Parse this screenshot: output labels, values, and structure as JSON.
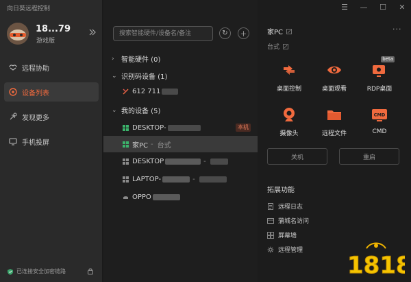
{
  "app": {
    "title": "向日葵远程控制"
  },
  "user": {
    "name": "18...79",
    "edition": "游戏版"
  },
  "nav": [
    {
      "label": "远程协助",
      "icon": "remote-assist-icon",
      "active": false
    },
    {
      "label": "设备列表",
      "icon": "device-list-icon",
      "active": true
    },
    {
      "label": "发现更多",
      "icon": "discover-icon",
      "active": false
    },
    {
      "label": "手机投屏",
      "icon": "screen-cast-icon",
      "active": false
    }
  ],
  "status": {
    "secure_link": "已连接安全加密链路"
  },
  "search": {
    "placeholder": "搜索智能硬件/设备名/备注"
  },
  "groups": {
    "smart_hardware": "智能硬件 (0)",
    "code_devices": "识别码设备 (1)",
    "my_devices": "我的设备 (5)"
  },
  "devices": {
    "code_device": {
      "id_prefix": "612 711"
    },
    "my": [
      {
        "name": "DESKTOP-",
        "badge": "本机"
      },
      {
        "name": "家PC",
        "separator": "-",
        "subtitle": "台式"
      },
      {
        "name": "DESKTOP",
        "separator": "-"
      },
      {
        "name": "LAPTOP-",
        "separator": "-"
      },
      {
        "name": "OPPO"
      }
    ]
  },
  "detail": {
    "name": "家PC",
    "type": "台式",
    "more": "···",
    "features": [
      {
        "label": "桌面控制",
        "icon": "desktop-control-icon"
      },
      {
        "label": "桌面观看",
        "icon": "desktop-view-icon"
      },
      {
        "label": "RDP桌面",
        "icon": "rdp-desktop-icon",
        "badge": "beta"
      },
      {
        "label": "摄像头",
        "icon": "camera-icon"
      },
      {
        "label": "远程文件",
        "icon": "remote-file-icon"
      },
      {
        "label": "CMD",
        "icon": "cmd-icon",
        "icon_text": "CMD"
      }
    ],
    "shutdown_label": "关机",
    "restart_label": "重启",
    "extensions_title": "拓展功能",
    "extensions": [
      {
        "label": "远程日志",
        "icon": "log-icon"
      },
      {
        "label": "蒲城名访问",
        "icon": "domain-access-icon"
      },
      {
        "label": "屏幕墙",
        "icon": "screen-wall-icon"
      },
      {
        "label": "远程管理",
        "icon": "remote-manage-icon"
      }
    ]
  },
  "colors": {
    "accent": "#f06a3e",
    "sidebar_bg": "#2a2a2a",
    "panel_bg": "#1e1e1e",
    "selected_bg": "#3a3a3a"
  }
}
